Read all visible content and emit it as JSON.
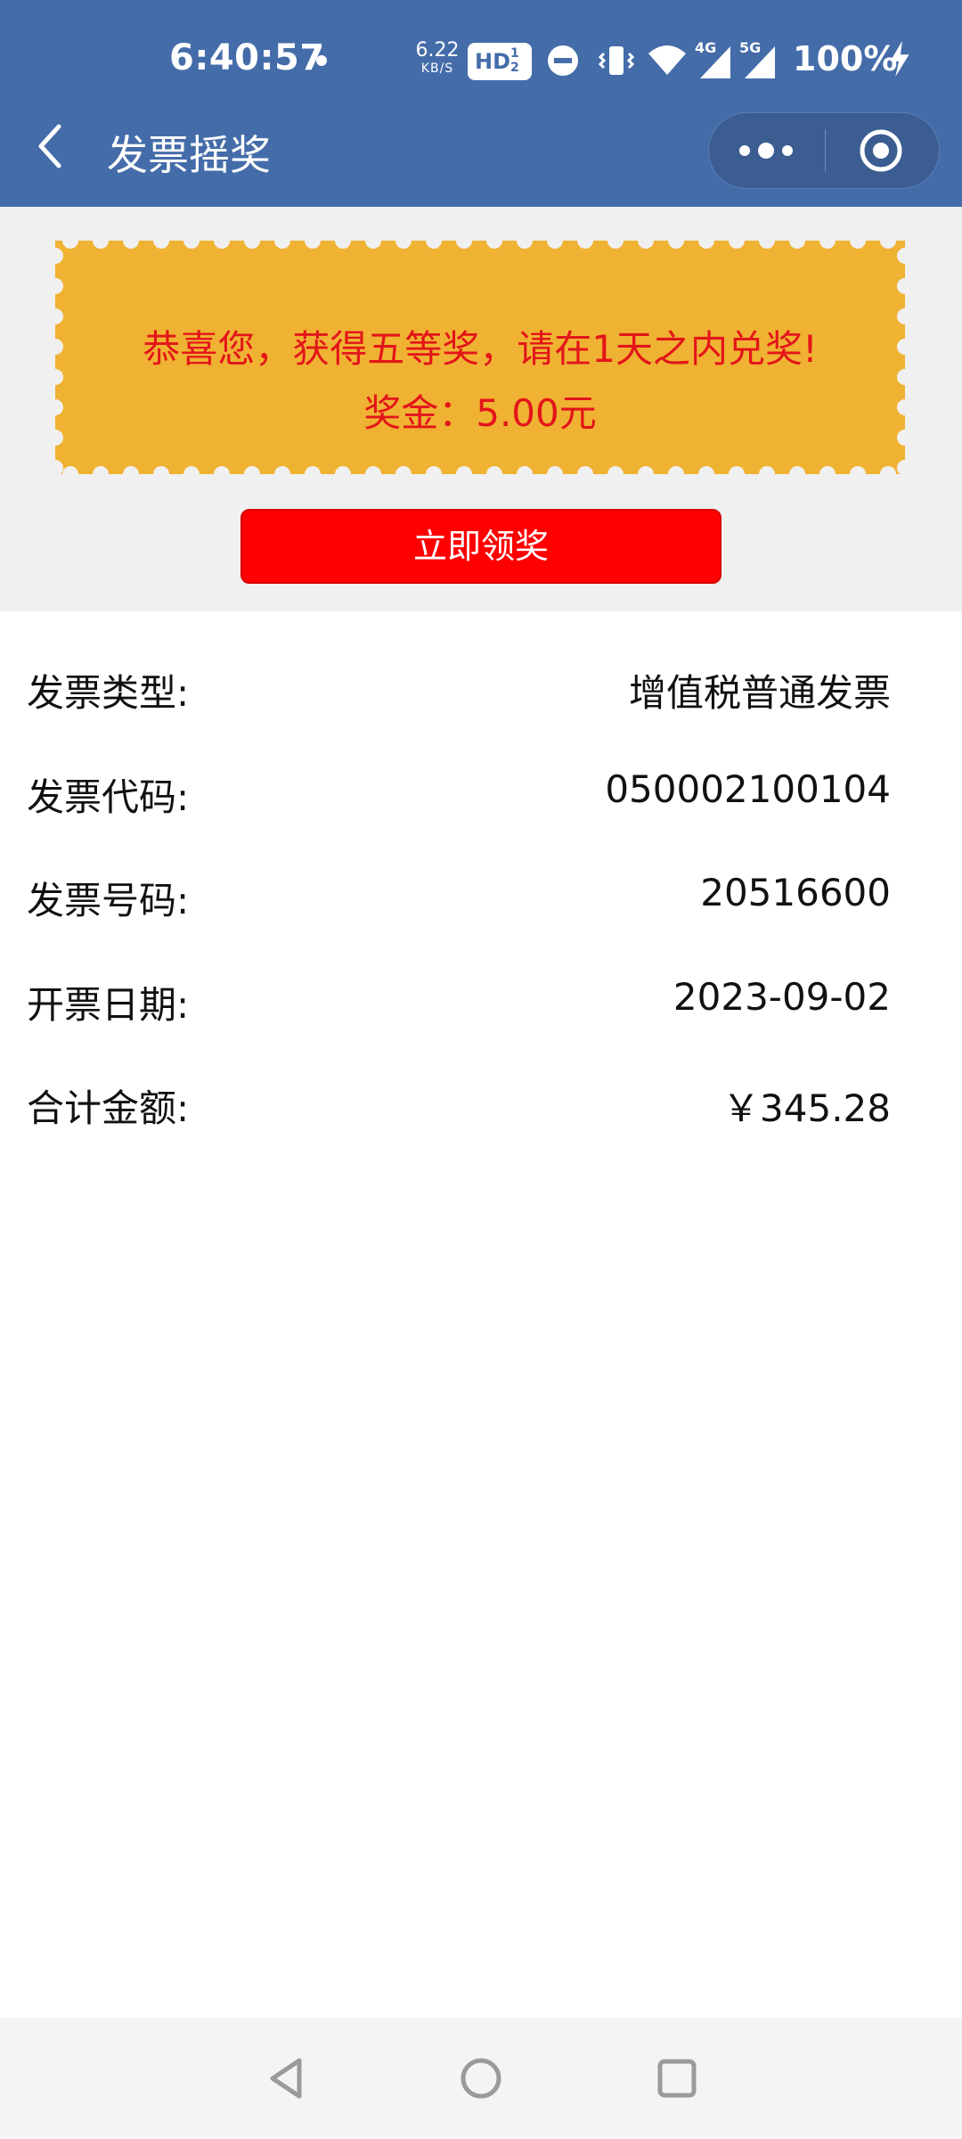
{
  "status_bar": {
    "time": "6:40:57",
    "net_speed": "6.22",
    "net_unit": "KB/S",
    "hd_label": "HD",
    "network_4g": "4G",
    "network_5g": "5G",
    "battery": "100%"
  },
  "app_bar": {
    "title": "发票摇奖",
    "color": "#446ca9"
  },
  "prize": {
    "message": "恭喜您，获得五等奖，请在1天之内兑奖!",
    "amount_text": "奖金：5.00元",
    "ticket_color": "#f0b232",
    "text_color": "#e3151a",
    "claim_button": "立即领奖",
    "button_color": "#ff0000"
  },
  "invoice": {
    "rows": [
      {
        "label": "发票类型:",
        "value": "增值税普通发票"
      },
      {
        "label": "发票代码:",
        "value": "050002100104"
      },
      {
        "label": "发票号码:",
        "value": "20516600"
      },
      {
        "label": "开票日期:",
        "value": "2023-09-02"
      },
      {
        "label": "合计金额:",
        "value": "￥345.28"
      }
    ]
  },
  "icons": {
    "back": "chevron-left-icon",
    "more": "more-dots-icon",
    "close": "target-close-icon",
    "nav_back": "triangle-back-icon",
    "nav_home": "circle-home-icon",
    "nav_recent": "square-recents-icon"
  }
}
